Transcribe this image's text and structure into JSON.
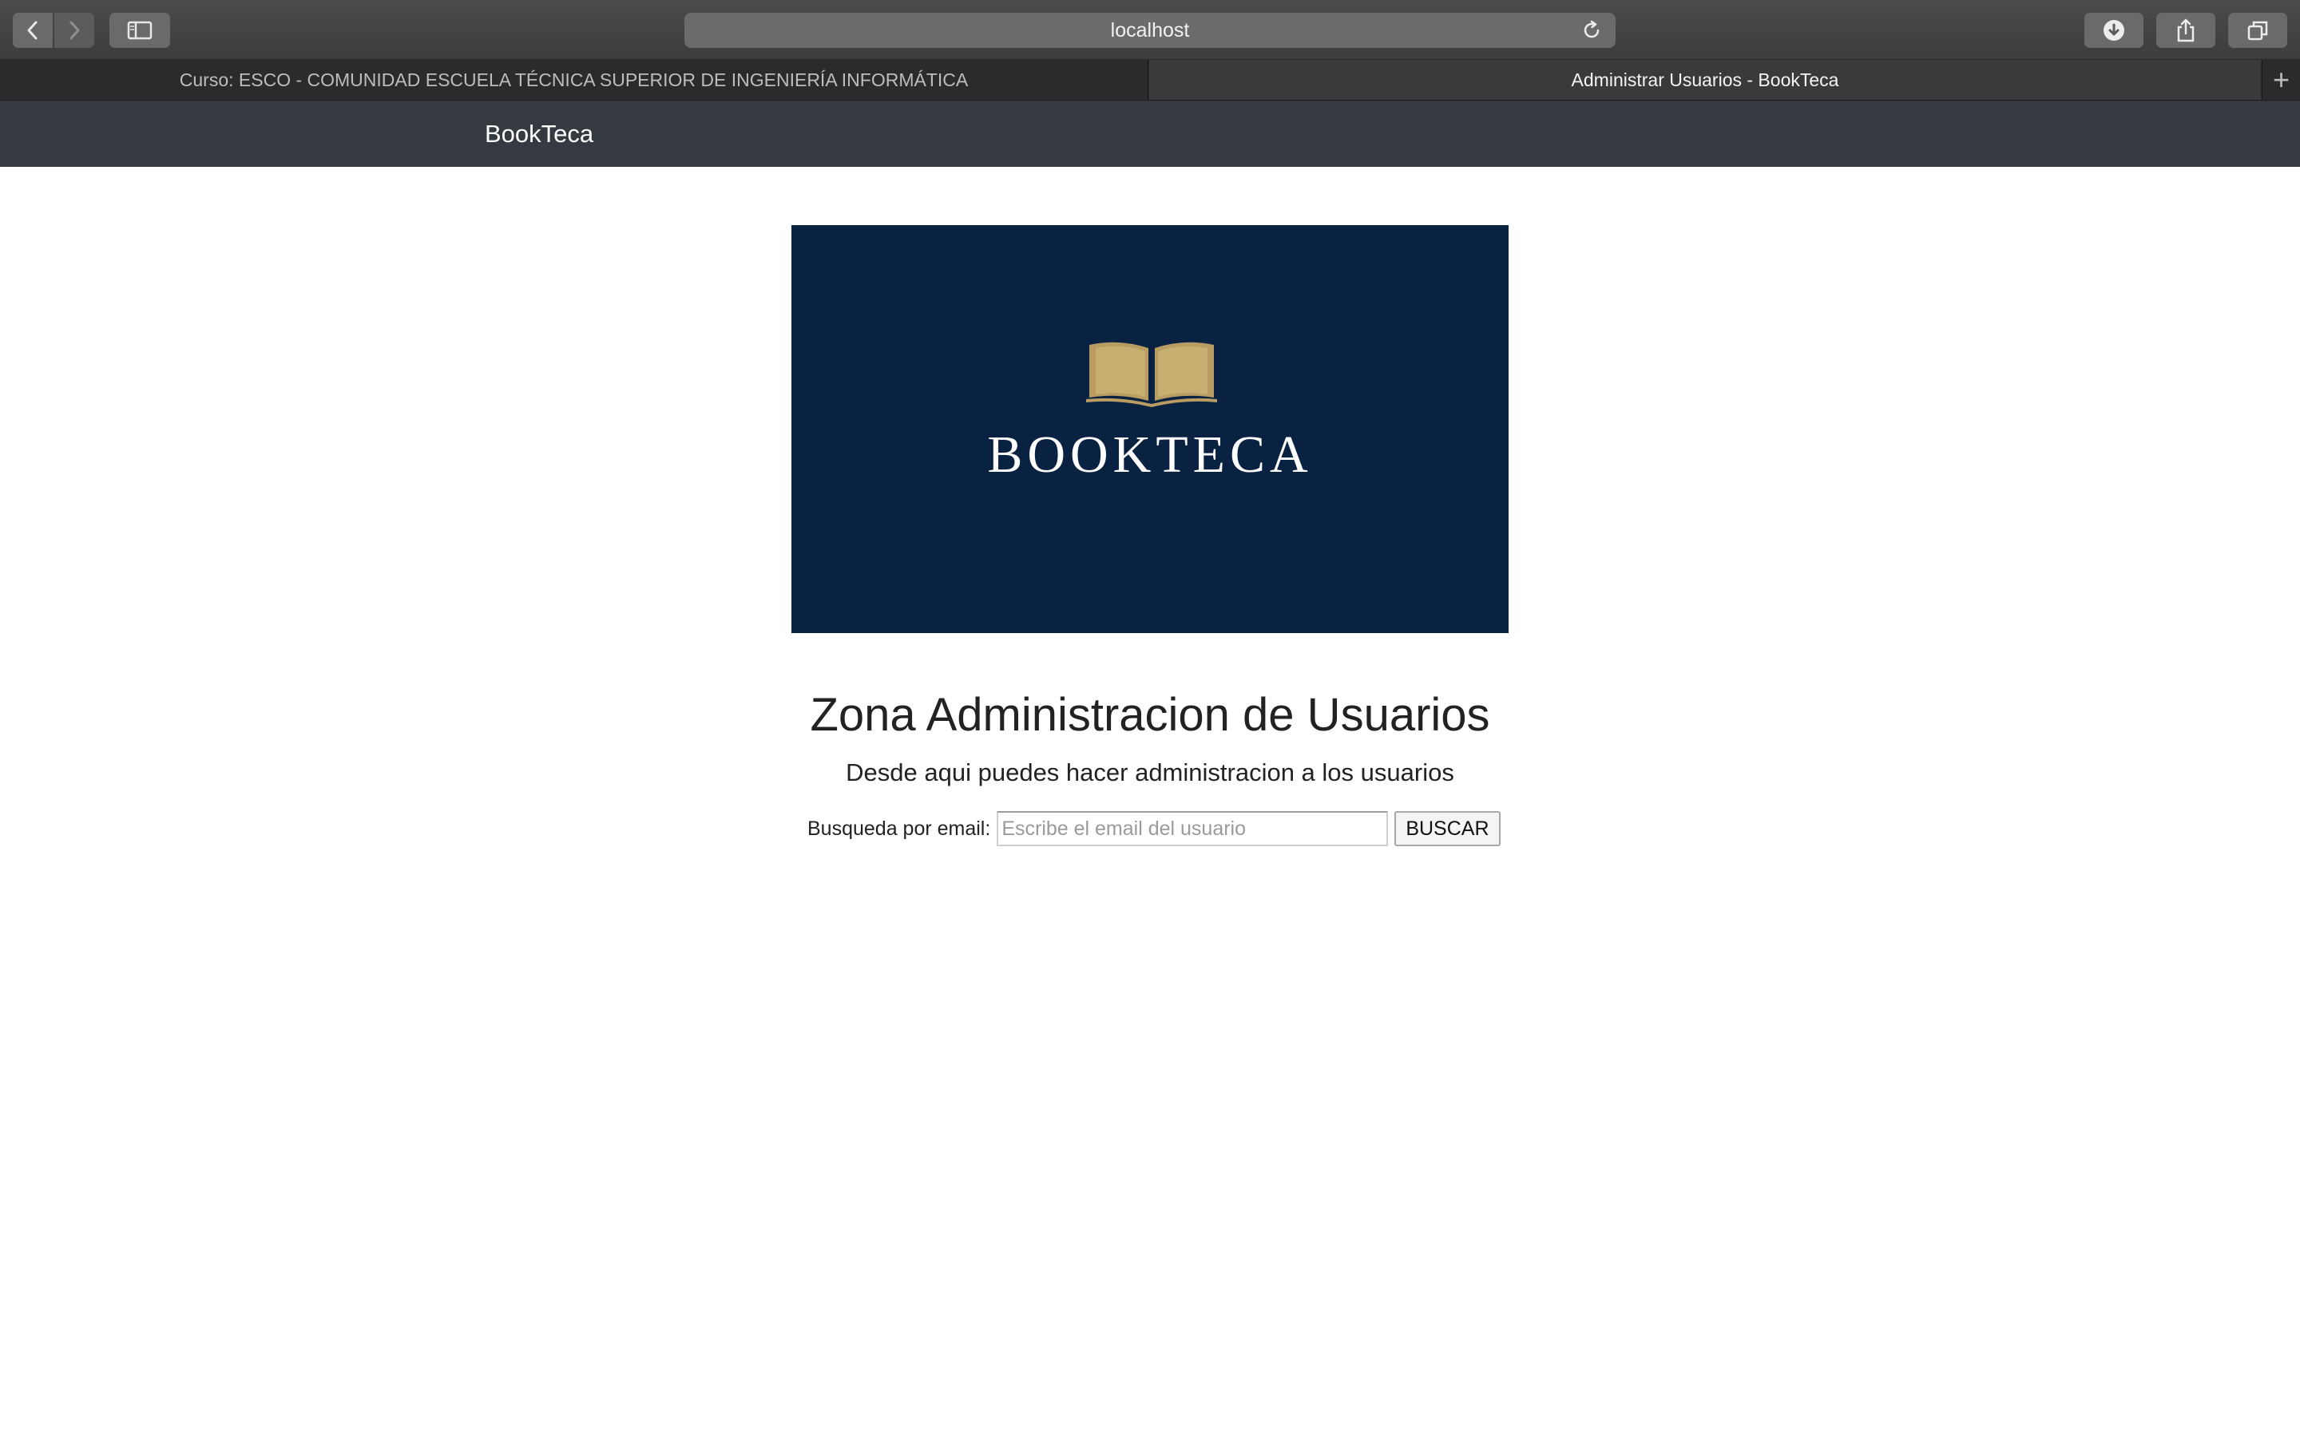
{
  "browser": {
    "url": "localhost",
    "tabs": [
      {
        "label": "Curso: ESCO - COMUNIDAD ESCUELA TÉCNICA SUPERIOR DE INGENIERÍA INFORMÁTICA",
        "active": false
      },
      {
        "label": "Administrar Usuarios - BookTeca",
        "active": true
      }
    ],
    "icons": {
      "back": "chevron-left-icon",
      "forward": "chevron-right-icon",
      "sidebar": "sidebar-icon",
      "reload": "reload-icon",
      "download": "download-icon",
      "share": "share-icon",
      "tabs": "tabs-overview-icon",
      "new_tab": "plus-icon"
    }
  },
  "navbar": {
    "brand": "BookTeca",
    "background": "#343a40"
  },
  "banner": {
    "logo_text": "BOOKTECA",
    "background": "#0a2242",
    "book_color": "#b89c62"
  },
  "main": {
    "title": "Zona Administracion de Usuarios",
    "subtitle": "Desde aqui puedes hacer administracion a los usuarios",
    "search": {
      "label": "Busqueda por email:",
      "placeholder": "Escribe el email del usuario",
      "value": "",
      "button_label": "BUSCAR"
    }
  }
}
